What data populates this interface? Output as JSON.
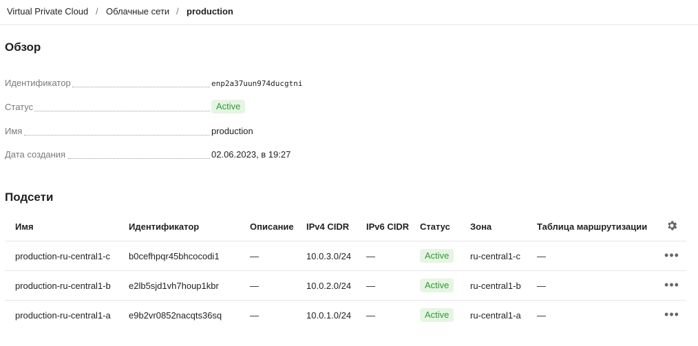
{
  "breadcrumbs": [
    "Virtual Private Cloud",
    "Облачные сети",
    "production"
  ],
  "breadcrumb_separator": "/",
  "overview": {
    "title": "Обзор",
    "properties": [
      {
        "label": "Идентификатор",
        "value": "enp2a37uun974ducgtni"
      },
      {
        "label": "Статус",
        "value": "Active"
      },
      {
        "label": "Имя",
        "value": "production"
      },
      {
        "label": "Дата создания",
        "value": "02.06.2023, в 19:27"
      }
    ]
  },
  "subnets": {
    "title": "Подсети",
    "columns": [
      "Имя",
      "Идентификатор",
      "Описание",
      "IPv4 CIDR",
      "IPv6 CIDR",
      "Статус",
      "Зона",
      "Таблица маршрутизации"
    ],
    "settings_icon": "gear-icon",
    "rows": [
      {
        "name": "production-ru-central1-c",
        "id": "b0cefhpqr45bhcocodi1",
        "description": "—",
        "ipv4": "10.0.3.0/24",
        "ipv6": "—",
        "status": "Active",
        "zone": "ru-central1-c",
        "route_table": "—",
        "actions": "•••"
      },
      {
        "name": "production-ru-central1-b",
        "id": "e2lb5sjd1vh7houp1kbr",
        "description": "—",
        "ipv4": "10.0.2.0/24",
        "ipv6": "—",
        "status": "Active",
        "zone": "ru-central1-b",
        "route_table": "—",
        "actions": "•••"
      },
      {
        "name": "production-ru-central1-a",
        "id": "e9b2vr0852nacqts36sq",
        "description": "—",
        "ipv4": "10.0.1.0/24",
        "ipv6": "—",
        "status": "Active",
        "zone": "ru-central1-a",
        "route_table": "—",
        "actions": "•••"
      }
    ]
  },
  "colors": {
    "status_active_bg": "#e6f5e3",
    "status_active_text": "#2f9a34"
  }
}
